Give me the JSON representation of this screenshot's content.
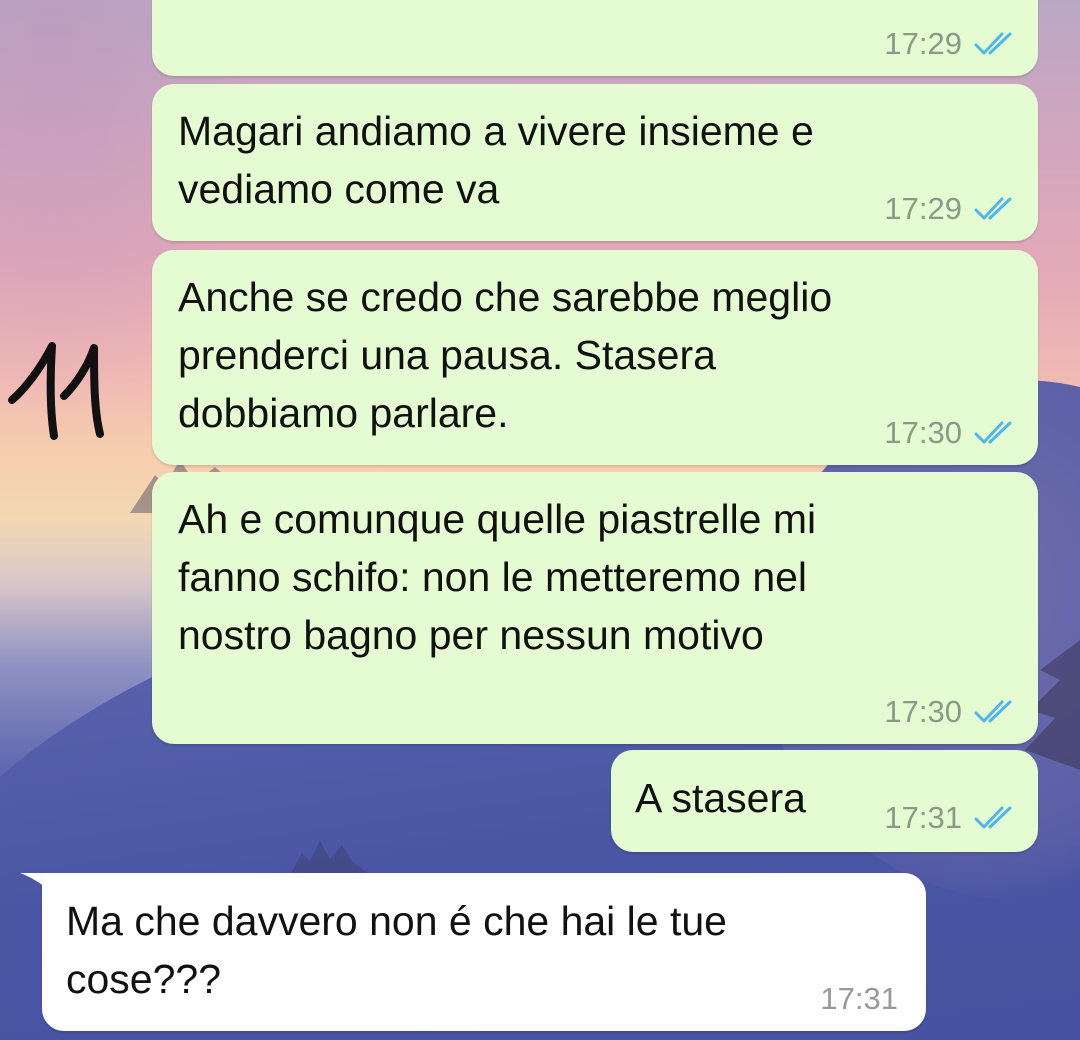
{
  "colors": {
    "outgoing_bubble": "#e5fcd2",
    "incoming_bubble": "#ffffff",
    "read_receipt": "#4fb6ec",
    "timestamp": "#8a9a86"
  },
  "annotation": {
    "text": "11"
  },
  "messages": [
    {
      "direction": "outgoing",
      "lines": [],
      "time": "17:29",
      "status_icon": "double-check-read-icon"
    },
    {
      "direction": "outgoing",
      "lines": [
        "Magari andiamo a vivere insieme e",
        "vediamo come va"
      ],
      "time": "17:29",
      "status_icon": "double-check-read-icon"
    },
    {
      "direction": "outgoing",
      "lines": [
        "Anche se credo che sarebbe meglio",
        "prenderci una pausa. Stasera",
        "dobbiamo parlare."
      ],
      "time": "17:30",
      "status_icon": "double-check-read-icon"
    },
    {
      "direction": "outgoing",
      "lines": [
        "Ah e comunque quelle piastrelle mi",
        "fanno schifo: non le metteremo nel",
        "nostro bagno per nessun motivo"
      ],
      "time": "17:30",
      "status_icon": "double-check-read-icon"
    },
    {
      "direction": "outgoing",
      "lines": [
        "A stasera"
      ],
      "time": "17:31",
      "status_icon": "double-check-read-icon"
    },
    {
      "direction": "incoming",
      "lines": [
        "Ma che davvero non é che hai le tue",
        "cose???"
      ],
      "time": "17:31"
    }
  ]
}
